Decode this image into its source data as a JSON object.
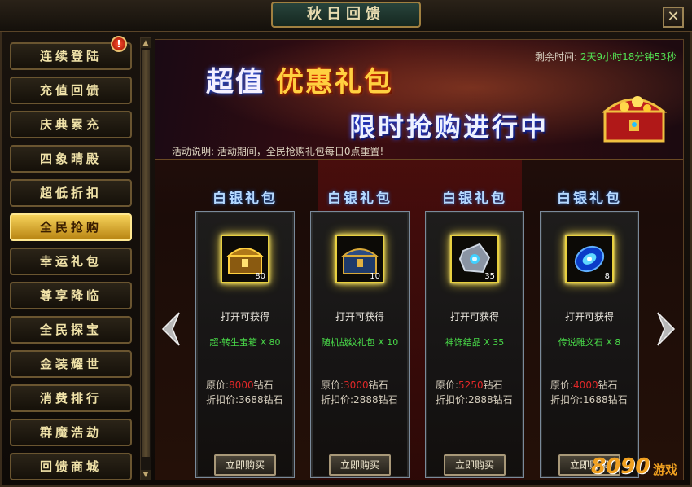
{
  "window": {
    "title": "秋日回馈",
    "close_label": "✕"
  },
  "sidebar": {
    "items": [
      {
        "label": "连续登陆"
      },
      {
        "label": "充值回馈"
      },
      {
        "label": "庆典累充"
      },
      {
        "label": "四象晴殿"
      },
      {
        "label": "超低折扣"
      },
      {
        "label": "全民抢购",
        "active": true
      },
      {
        "label": "幸运礼包"
      },
      {
        "label": "尊享降临"
      },
      {
        "label": "全民探宝"
      },
      {
        "label": "金装耀世"
      },
      {
        "label": "消费排行"
      },
      {
        "label": "群魔浩劫"
      },
      {
        "label": "回馈商城"
      }
    ],
    "notice_badge": "!"
  },
  "banner": {
    "headline_prefix": "超值",
    "headline_highlight": "优惠礼包",
    "subline": "限时抢购进行中",
    "remaining_label": "剩余时间:",
    "remaining_value": "2天9小时18分钟53秒",
    "description_label": "活动说明:",
    "description_text": "活动期间，全民抢购礼包每日0点重置!"
  },
  "common": {
    "open_label": "打开可获得",
    "original_price_label": "原价:",
    "discount_price_label": "折扣价:",
    "currency": "钻石",
    "buy_label": "立即购买"
  },
  "packages": [
    {
      "title": "白银礼包",
      "icon": "golden-treasure-chest-icon",
      "count": "80",
      "reward": "超·转生宝箱 X 80",
      "original_price": "8000",
      "discount_price": "3688"
    },
    {
      "title": "白银礼包",
      "icon": "blue-chest-icon",
      "count": "10",
      "reward": "随机战纹礼包 X 10",
      "original_price": "3000",
      "discount_price": "2888"
    },
    {
      "title": "白银礼包",
      "icon": "crystal-icon",
      "count": "35",
      "reward": "神饰结晶 X 35",
      "original_price": "5250",
      "discount_price": "2888"
    },
    {
      "title": "白银礼包",
      "icon": "rune-stone-icon",
      "count": "8",
      "reward": "传说雕文石 X 8",
      "original_price": "4000",
      "discount_price": "1688"
    }
  ],
  "logo": {
    "text": "8090",
    "sub": "游戏"
  },
  "colors": {
    "accent_gold": "#f6d25a",
    "reward_green": "#48d848",
    "price_red": "#e02828"
  }
}
